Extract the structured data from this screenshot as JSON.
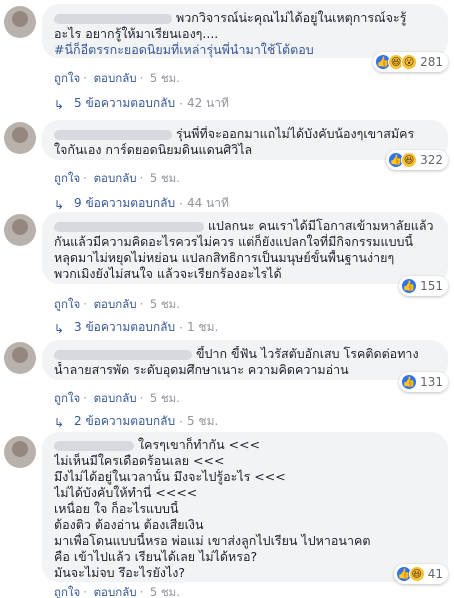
{
  "colors": {
    "link": "#385898",
    "meta": "#90949c",
    "bubble": "#f2f3f5",
    "like": "#2e74f2",
    "haha": "#f7c23a"
  },
  "icons": {
    "like": "like-icon",
    "haha": "haha-icon",
    "wow": "wow-icon",
    "reply_arrow": "reply-arrow-icon"
  },
  "comments": [
    {
      "lines": [
        "พวกวิจารณ์น่ะคุณไม่ได้อยู่ในเหตุการณ์จะรู้",
        "อะไร อยากรู้ให้มาเรียนเองๆ...."
      ],
      "hashtag": "#นี่ก็อีตรรกะยอดนิยมที่เหล่ารุ่นพี่นำมาใช้โต้ตอบ",
      "actions": {
        "like": "ถูกใจ",
        "sep": "·",
        "reply": "ตอบกลับ",
        "time": "5 ชม."
      },
      "reactions": {
        "count": "281"
      },
      "replies": {
        "text": "5 ข้อความตอบกลับ",
        "time": "42 นาที"
      }
    },
    {
      "lines": [
        "รุ่นพี่ที่จะออกมาแถไม่ได้บังคับน้องๆเขาสมัคร",
        "ใจกันเอง การ์ดยอดนิยมดินแดนศิวิไล"
      ],
      "actions": {
        "like": "ถูกใจ",
        "sep": "·",
        "reply": "ตอบกลับ",
        "time": "5 ชม."
      },
      "reactions": {
        "count": "322"
      },
      "replies": {
        "text": "9 ข้อความตอบกลับ",
        "time": "44 นาที"
      }
    },
    {
      "lines": [
        "แปลกนะ คนเราได้มีโอกาสเข้ามหาลัยแล้ว โตๆ",
        "กันแล้วมีความคิดอะไรควรไม่ควร แต่ก็ยังแปลกใจที่มีกิจกรรมแบบนี้",
        "หลุดมาไม่หยุดไม่หย่อน แปลกสิทธิการเป็นมนุษย์ขั้นพื้นฐานง่ายๆ",
        "พวกเมิงยังไม่สนใจ แล้วจะเรียกร้องอะไรได้"
      ],
      "actions": {
        "like": "ถูกใจ",
        "sep": "·",
        "reply": "ตอบกลับ",
        "time": "5 ชม."
      },
      "reactions": {
        "count": "151"
      },
      "replies": {
        "text": "3 ข้อความตอบกลับ",
        "time": "1 ชม."
      }
    },
    {
      "lines": [
        "ขี้ปาก ขี้ฟัน ไวรัสตับอักเสบ โรคติดต่อทาง",
        "น้ำลายสารพัด ระดับอุดมศึกษาเนาะ ความคิดความอ่าน"
      ],
      "actions": {
        "like": "ถูกใจ",
        "sep": "·",
        "reply": "ตอบกลับ",
        "time": "5 ชม."
      },
      "reactions": {
        "count": "131"
      },
      "replies": {
        "text": "2 ข้อความตอบกลับ",
        "time": "5 ชม."
      }
    },
    {
      "lines": [
        "ใครๆเขาก็ทำกัน <<<",
        "ไม่เห็นมีใครเดือดร้อนเลย <<<",
        "มึงไม่ได้อยู่ในเวลานั้น มึงจะไปรู้อะไร <<<",
        "ไม่ได้บังคับให้ทำนี่ <<<<",
        "เหนื่อย ใจ ก็อะไรแบบนี้",
        "ต้องติว ต้องอ่าน ต้องเสียเงิน",
        "มาเพื่อโดนแบบนี้หรอ พ่อแม่ เขาส่งลูกไปเรียน ไปหาอนาคต",
        "คือ เข้าไปแล้ว เรียนได้เลย ไม่ได้หรอ?",
        "มันจะไม่จบ รึอะไรยังไง?"
      ],
      "actions": {
        "like": "ถูกใจ",
        "sep": "·",
        "reply": "ตอบกลับ",
        "time": "5 ชม."
      },
      "reactions": {
        "count": "41"
      }
    }
  ]
}
